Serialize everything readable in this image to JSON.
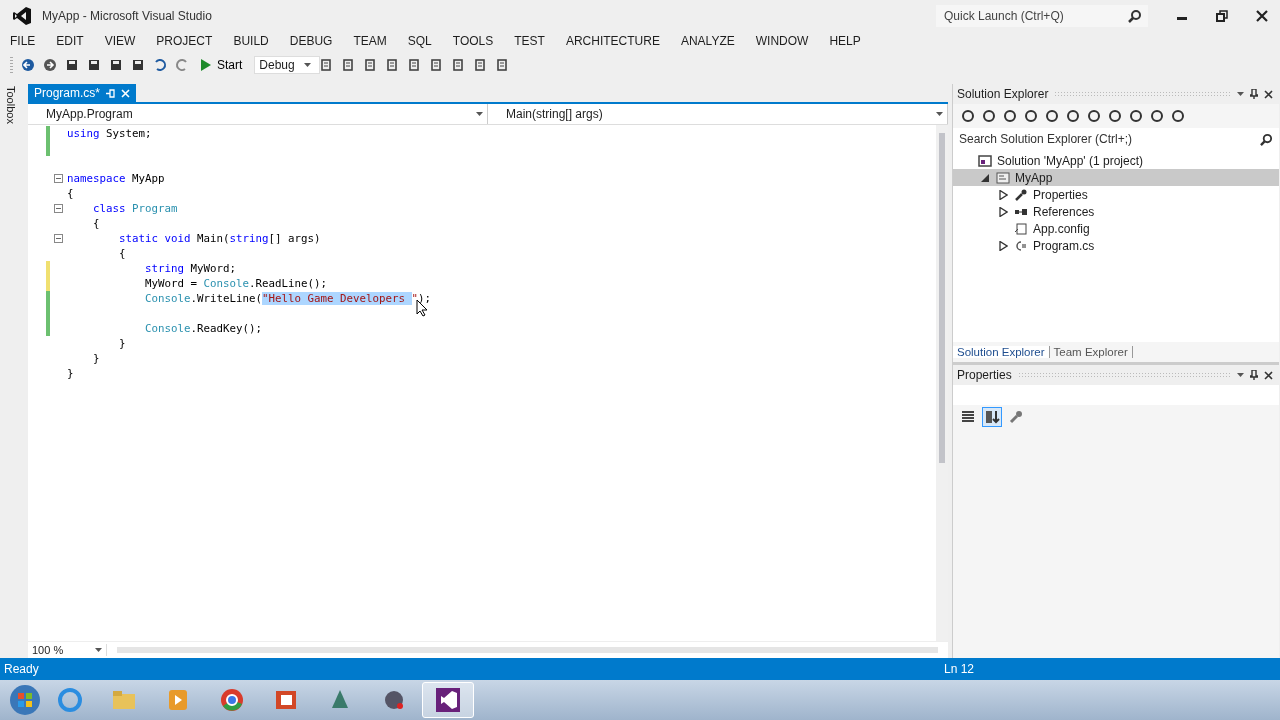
{
  "window": {
    "title": "MyApp - Microsoft Visual Studio",
    "quick_launch": {
      "placeholder": "Quick Launch (Ctrl+Q)"
    }
  },
  "menu": [
    "FILE",
    "EDIT",
    "VIEW",
    "PROJECT",
    "BUILD",
    "DEBUG",
    "TEAM",
    "SQL",
    "TOOLS",
    "TEST",
    "ARCHITECTURE",
    "ANALYZE",
    "WINDOW",
    "HELP"
  ],
  "toolbar": {
    "start": "Start",
    "configuration": "Debug"
  },
  "side_tab": "Toolbox",
  "document_tabs": [
    {
      "label": "Program.cs*",
      "selected": true
    }
  ],
  "navigation": {
    "type": "MyApp.Program",
    "member": "Main(string[] args)"
  },
  "code_lines": [
    {
      "changed": true,
      "saved": true,
      "fold": false,
      "tokens": [
        {
          "kind": "keyword",
          "text": "using"
        },
        {
          "kind": "plain",
          "text": " System;"
        }
      ]
    },
    {
      "changed": true,
      "saved": true,
      "fold": false
    },
    {
      "changed": false,
      "fold": false
    },
    {
      "changed": false,
      "fold": true,
      "tokens": [
        {
          "kind": "keyword",
          "text": "namespace"
        },
        {
          "kind": "plain",
          "text": " MyApp"
        }
      ]
    },
    {
      "changed": false,
      "fold": false,
      "tokens": [
        {
          "kind": "plain",
          "text": "{"
        }
      ]
    },
    {
      "changed": false,
      "fold": true,
      "tokens": [
        {
          "kind": "keyword",
          "text": "    class"
        },
        {
          "kind": "type",
          "text": " Program"
        }
      ]
    },
    {
      "changed": false,
      "fold": false,
      "tokens": [
        {
          "kind": "plain",
          "text": "    {"
        }
      ]
    },
    {
      "changed": false,
      "fold": true,
      "tokens": [
        {
          "kind": "keyword",
          "text": "        static void"
        },
        {
          "kind": "plain",
          "text": " Main("
        },
        {
          "kind": "keyword",
          "text": "string"
        },
        {
          "kind": "plain",
          "text": "[] args)"
        }
      ]
    },
    {
      "changed": false,
      "fold": false,
      "tokens": [
        {
          "kind": "plain",
          "text": "        {"
        }
      ]
    },
    {
      "changed": true,
      "saved": false,
      "fold": false,
      "tokens": [
        {
          "kind": "keyword",
          "text": "            string"
        },
        {
          "kind": "plain",
          "text": " MyWord;"
        }
      ]
    },
    {
      "changed": true,
      "saved": false,
      "fold": false,
      "tokens": [
        {
          "kind": "plain",
          "text": "            MyWord = "
        },
        {
          "kind": "type",
          "text": "Console"
        },
        {
          "kind": "plain",
          "text": ".ReadLine();"
        }
      ]
    },
    {
      "changed": true,
      "saved": true,
      "fold": false,
      "tokens": [
        {
          "kind": "type",
          "text": "            Console"
        },
        {
          "kind": "plain",
          "text": ".WriteLine("
        },
        {
          "kind": "selected",
          "text": "\"Hello Game Developers "
        },
        {
          "kind": "string",
          "text": "\""
        },
        {
          "kind": "plain",
          "text": ");"
        }
      ]
    },
    {
      "changed": true,
      "saved": true,
      "fold": false
    },
    {
      "changed": true,
      "saved": true,
      "fold": false,
      "tokens": [
        {
          "kind": "type",
          "text": "            Console"
        },
        {
          "kind": "plain",
          "text": ".ReadKey();"
        }
      ]
    },
    {
      "changed": false,
      "fold": false,
      "tokens": [
        {
          "kind": "plain",
          "text": "        }"
        }
      ]
    },
    {
      "changed": false,
      "fold": false,
      "tokens": [
        {
          "kind": "plain",
          "text": "    }"
        }
      ]
    },
    {
      "changed": false,
      "fold": false,
      "tokens": [
        {
          "kind": "plain",
          "text": "}"
        }
      ]
    }
  ],
  "zoom": "100 %",
  "solution_explorer": {
    "title": "Solution Explorer",
    "search": {
      "placeholder": "Search Solution Explorer (Ctrl+;)"
    },
    "tree": [
      {
        "label": "Solution 'MyApp' (1 project)",
        "kind": "solution",
        "selected": false,
        "children": [
          {
            "label": "MyApp",
            "kind": "project",
            "selected": true,
            "expanded": true,
            "children": [
              {
                "label": "Properties",
                "kind": "properties",
                "selected": false,
                "expanded": false
              },
              {
                "label": "References",
                "kind": "references",
                "selected": false,
                "expanded": false
              },
              {
                "label": "App.config",
                "kind": "config",
                "selected": false
              },
              {
                "label": "Program.cs",
                "kind": "csharp",
                "selected": false,
                "expanded": false
              }
            ]
          }
        ]
      }
    ],
    "tabs": [
      {
        "label": "Solution Explorer",
        "selected": true
      },
      {
        "label": "Team Explorer",
        "selected": false
      }
    ]
  },
  "properties": {
    "title": "Properties"
  },
  "status_bar": {
    "state": "Ready",
    "line": "Ln 12"
  }
}
